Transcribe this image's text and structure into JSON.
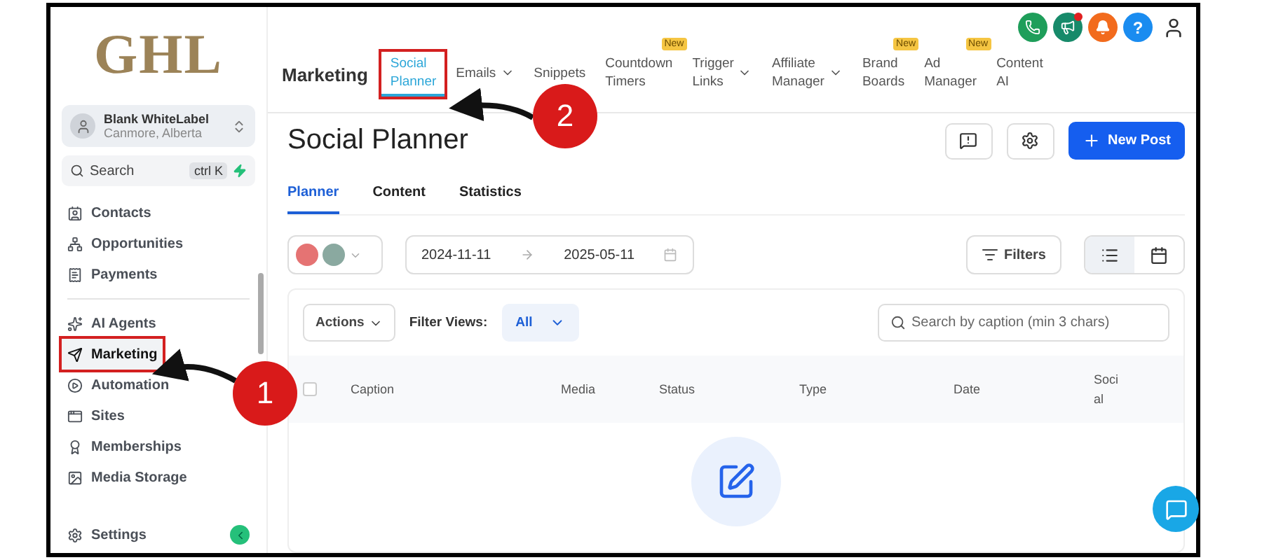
{
  "sidebar": {
    "logo": "GHL",
    "account": {
      "name": "Blank WhiteLabel",
      "location": "Canmore, Alberta"
    },
    "search": {
      "placeholder": "Search",
      "shortcut": "ctrl K"
    },
    "items": [
      {
        "label": "Contacts",
        "selected": false,
        "highlighted": false
      },
      {
        "label": "Opportunities",
        "selected": false,
        "highlighted": false
      },
      {
        "label": "Payments",
        "selected": false,
        "highlighted": false
      },
      {
        "label": "AI Agents",
        "selected": false,
        "highlighted": false
      },
      {
        "label": "Marketing",
        "selected": true,
        "highlighted": true
      },
      {
        "label": "Automation",
        "selected": false,
        "highlighted": false
      },
      {
        "label": "Sites",
        "selected": false,
        "highlighted": false
      },
      {
        "label": "Memberships",
        "selected": false,
        "highlighted": false
      },
      {
        "label": "Media Storage",
        "selected": false,
        "highlighted": false
      }
    ],
    "footer": {
      "label": "Settings"
    }
  },
  "header": {
    "section": "Marketing",
    "nav": [
      {
        "label": "Social Planner",
        "selected": true,
        "highlighted": true,
        "dropdown": false
      },
      {
        "label": "Emails",
        "selected": false,
        "highlighted": false,
        "dropdown": true
      },
      {
        "label": "Snippets",
        "selected": false,
        "highlighted": false,
        "dropdown": false
      },
      {
        "label": "Countdown Timers",
        "selected": false,
        "highlighted": false,
        "dropdown": false,
        "badge": "New"
      },
      {
        "label": "Trigger Links",
        "selected": false,
        "highlighted": false,
        "dropdown": true
      },
      {
        "label": "Affiliate Manager",
        "selected": false,
        "highlighted": false,
        "dropdown": true
      },
      {
        "label": "Brand Boards",
        "selected": false,
        "highlighted": false,
        "dropdown": false,
        "badge": "New"
      },
      {
        "label": "Ad Manager",
        "selected": false,
        "highlighted": false,
        "dropdown": false,
        "badge": "New"
      },
      {
        "label": "Content AI",
        "selected": false,
        "highlighted": false,
        "dropdown": false
      }
    ],
    "top_icons": [
      {
        "kind": "phone",
        "color": "#1e9e5a",
        "dot": false
      },
      {
        "kind": "megaphone",
        "color": "#178a6a",
        "dot": true
      },
      {
        "kind": "bell",
        "color": "#f26b1d",
        "dot": false
      },
      {
        "kind": "help",
        "color": "#1a8cf0",
        "dot": false,
        "label": "?"
      },
      {
        "kind": "avatar",
        "color": "#ffffff",
        "dot": false
      }
    ]
  },
  "page": {
    "title": "Social Planner",
    "new_post": "New Post",
    "tabs": [
      {
        "label": "Planner",
        "selected": true
      },
      {
        "label": "Content",
        "selected": false
      },
      {
        "label": "Statistics",
        "selected": false
      }
    ],
    "date_from": "2024-11-11",
    "date_to": "2025-05-11",
    "filters": "Filters",
    "views": [
      {
        "kind": "list",
        "selected": true
      },
      {
        "kind": "calendar",
        "selected": false
      }
    ],
    "table": {
      "actions": "Actions",
      "filter_label": "Filter Views:",
      "filter_value": "All",
      "search_placeholder": "Search by caption (min 3 chars)",
      "select_all_checked": false,
      "columns": [
        "Caption",
        "Media",
        "Status",
        "Type",
        "Date",
        "Social"
      ]
    }
  },
  "callouts": [
    {
      "number": "1"
    },
    {
      "number": "2"
    }
  ]
}
